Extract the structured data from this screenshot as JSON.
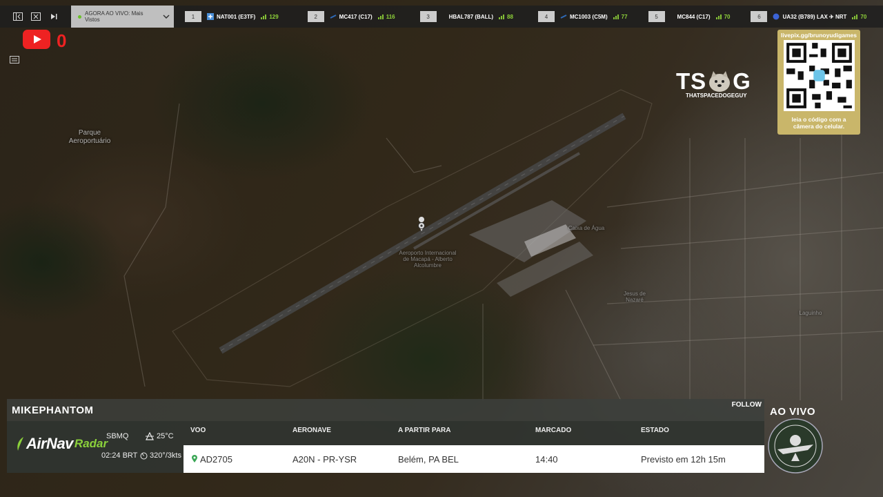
{
  "topbar": {
    "live_label": "AGORA AO VIVO: Mais Vistos",
    "flights": [
      {
        "num": "1",
        "callsign": "NAT001 (E3TF)",
        "score": "129",
        "icon_color": "#4a8fd8"
      },
      {
        "num": "2",
        "callsign": "MC417 (C17)",
        "score": "116",
        "icon_color": "#2e6ab8"
      },
      {
        "num": "3",
        "callsign": "HBAL787 (BALL)",
        "score": "88",
        "icon_color": ""
      },
      {
        "num": "4",
        "callsign": "MC1003 (C5M)",
        "score": "77",
        "icon_color": "#2e6ab8"
      },
      {
        "num": "5",
        "callsign": "MC844 (C17)",
        "score": "70",
        "icon_color": ""
      },
      {
        "num": "6",
        "callsign": "UA32 (B789) LAX ✈ NRT",
        "score": "70",
        "icon_color": "#3b63d6"
      }
    ]
  },
  "youtube": {
    "count": "0"
  },
  "map_labels": {
    "park": "Parque\nAeroportuário",
    "airport": "Aeroporto Internacional\nde Macapá - Alberto\nAlcolumbre",
    "caixa": "Caixa de Água",
    "jesus": "Jesus de\nNazaré",
    "laguinho": "Laguinho"
  },
  "tsg": {
    "text_left": "TS",
    "text_right": "G",
    "subtitle": "THATSPACEDOGEGUY"
  },
  "qr": {
    "url": "livepix.gg/brunoyudigames",
    "caption": "leia o código com a\ncâmera do celular."
  },
  "bottom": {
    "streamer": "MIKEPHANTOM",
    "follow": "FOLLOW",
    "brand": "AirNav",
    "brand_radar": "Radar",
    "airport_code": "SBMQ",
    "time": "02:24 BRT",
    "temp": "25°C",
    "wind": "320°/3kts",
    "headers": {
      "flight": "VOO",
      "aircraft": "AERONAVE",
      "destination": "A PARTIR PARA",
      "scheduled": "MARCADO",
      "status": "ESTADO"
    },
    "row": {
      "flight": "AD2705",
      "aircraft": "A20N - PR-YSR",
      "destination": "Belém, PA BEL",
      "scheduled": "14:40",
      "status": "Previsto em 12h 15m"
    }
  },
  "badge": {
    "live": "AO VIVO"
  },
  "colors": {
    "accent_green": "#8fd33a",
    "youtube_red": "#e22",
    "qr_frame": "#c9b66a"
  }
}
